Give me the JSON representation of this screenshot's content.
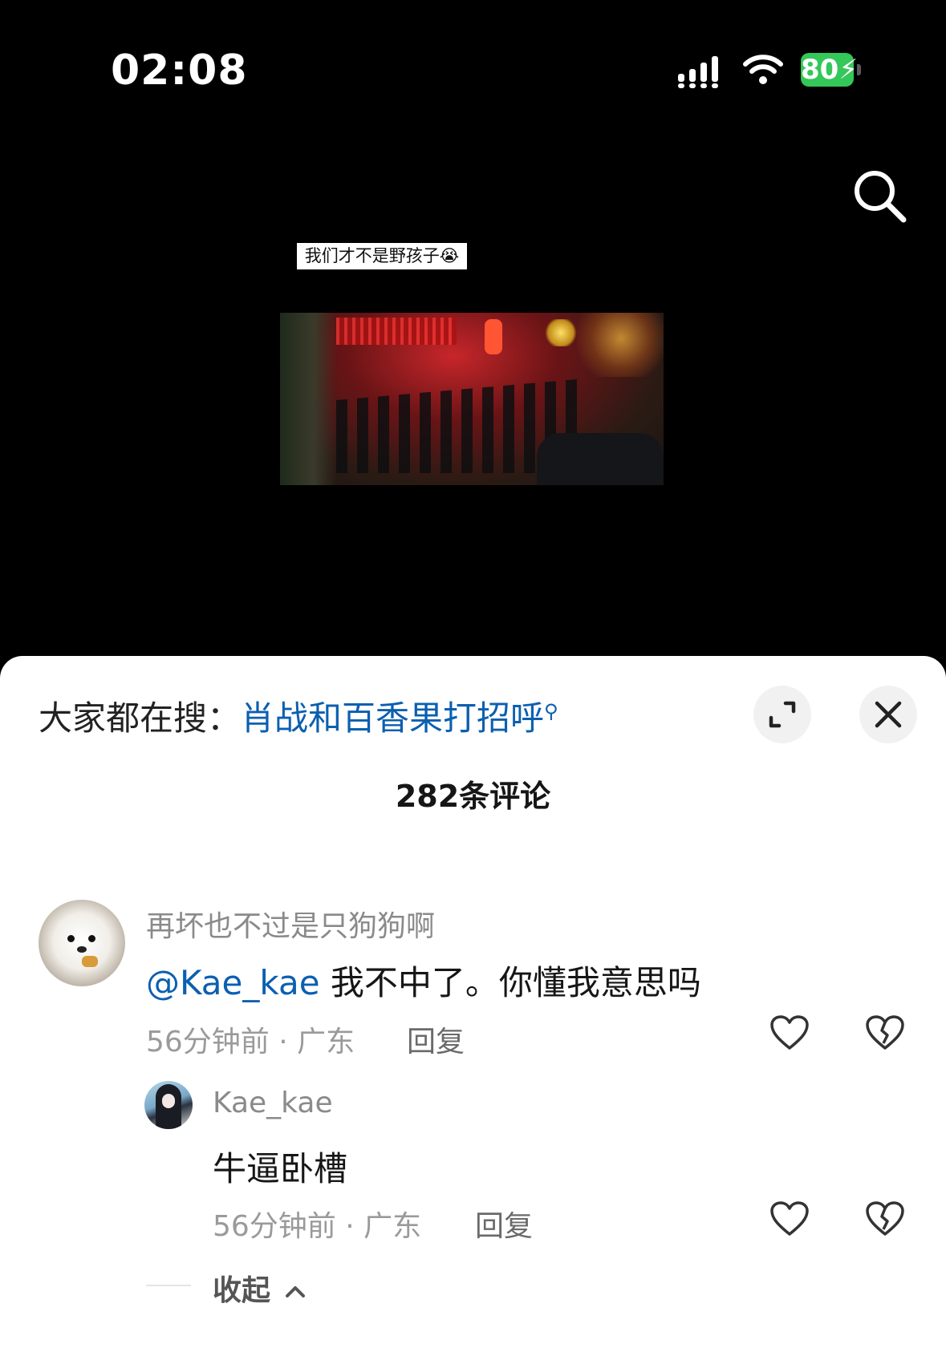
{
  "status_bar": {
    "time": "02:08",
    "battery": "80"
  },
  "video": {
    "caption": "我们才不是野孩子😭"
  },
  "sheet": {
    "trending_prefix": "大家都在搜：",
    "trending_keyword": "肖战和百香果打招呼",
    "comment_count": "282条评论"
  },
  "comments": [
    {
      "username": "再坏也不过是只狗狗啊",
      "mention": "@Kae_kae",
      "text": " 我不中了。你懂我意思吗",
      "meta": "56分钟前 · 广东",
      "reply_label": "回复",
      "replies": [
        {
          "username": "Kae_kae",
          "text": "牛逼卧槽",
          "meta": "56分钟前 · 广东",
          "reply_label": "回复"
        }
      ],
      "collapse_label": "收起"
    }
  ],
  "colors": {
    "link": "#0b5fb0",
    "battery": "#34c759"
  }
}
